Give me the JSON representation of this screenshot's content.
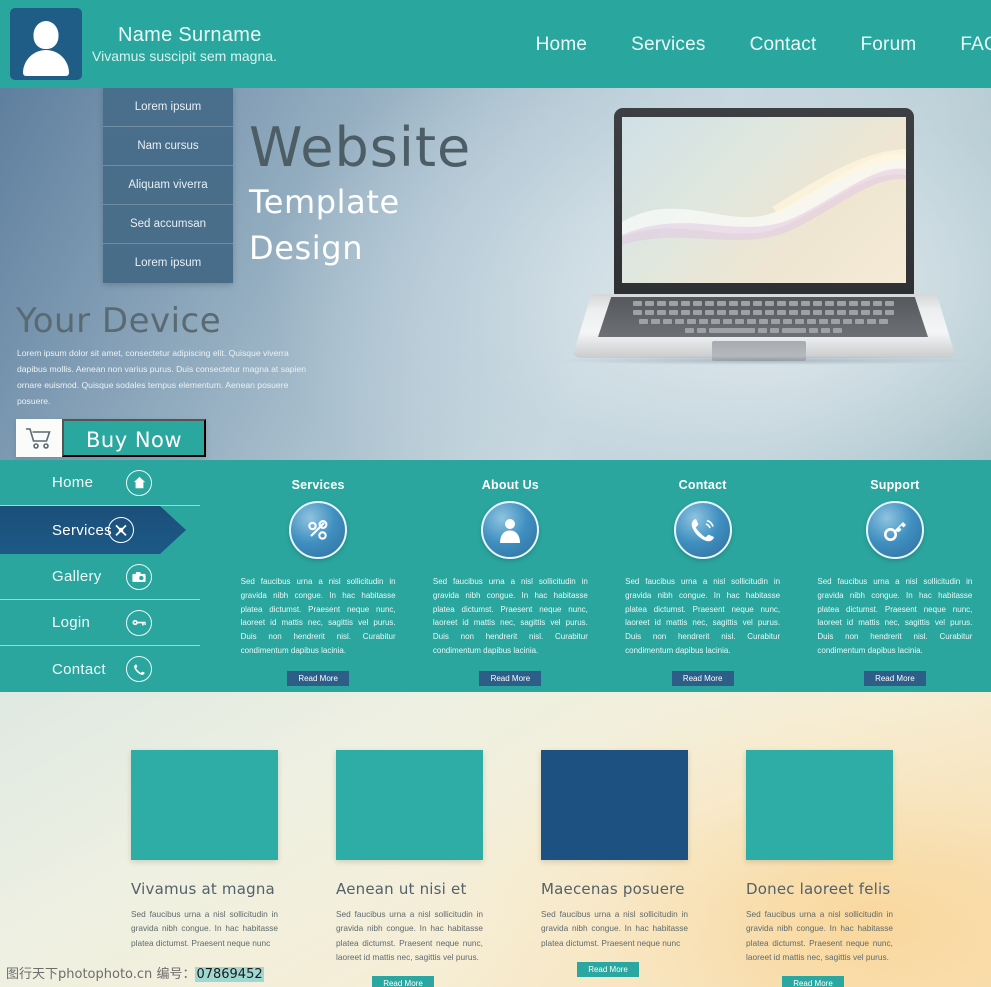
{
  "header": {
    "profile_name": "Name Surname",
    "profile_tagline": "Vivamus suscipit sem magna.",
    "avatar_icon": "user-avatar-icon",
    "nav": [
      {
        "label": "Home"
      },
      {
        "label": "Services"
      },
      {
        "label": "Contact"
      },
      {
        "label": "Forum"
      },
      {
        "label": "FAQ"
      }
    ],
    "bg_color": "#29a79f"
  },
  "dropdown": {
    "items": [
      {
        "label": "Lorem ipsum"
      },
      {
        "label": "Nam cursus"
      },
      {
        "label": "Aliquam viverra"
      },
      {
        "label": "Sed accumsan"
      },
      {
        "label": "Lorem ipsum"
      }
    ],
    "bg_color": "#4a6f8c"
  },
  "hero": {
    "title": "Website",
    "subtitle_line1": "Template",
    "subtitle_line2": "Design",
    "device_heading": "Your Device",
    "device_text": "Lorem ipsum dolor sit amet, consectetur adipiscing elit. Quisque viverra dapibus mollis. Aenean non varius purus. Duis consectetur magna at sapien ornare euismod. Quisque sodales tempus elementum. Aenean posuere posuere.",
    "buy_label": "Buy Now",
    "cart_icon": "shopping-cart-icon",
    "accent_color": "#2aa8a0"
  },
  "sidebar": {
    "items": [
      {
        "label": "Home",
        "icon": "home-icon",
        "glyph": "⌂",
        "active": false
      },
      {
        "label": "Services",
        "icon": "tools-icon",
        "glyph": "⚒",
        "active": true
      },
      {
        "label": "Gallery",
        "icon": "camera-icon",
        "glyph": "▣",
        "active": false
      },
      {
        "label": "Login",
        "icon": "key-icon",
        "glyph": "⚷",
        "active": false
      },
      {
        "label": "Contact",
        "icon": "phone-icon",
        "glyph": "☎",
        "active": false
      }
    ],
    "active_color": "#1b4f79"
  },
  "services": {
    "section_bg": "#2aa69f",
    "read_more_label": "Read More",
    "body_text": "Sed faucibus urna a nisl sollicitudin in gravida nibh congue. In hac habitasse platea dictumst. Praesent neque nunc, laoreet id mattis nec, sagittis vel purus. Duis non hendrerit nisl. Curabitur condimentum dapibus lacinia.",
    "cards": [
      {
        "title": "Services",
        "icon": "tools-gear-icon",
        "glyph": "⚙"
      },
      {
        "title": "About Us",
        "icon": "person-icon",
        "glyph": "♟"
      },
      {
        "title": "Contact",
        "icon": "phone-ring-icon",
        "glyph": "☎"
      },
      {
        "title": "Support",
        "icon": "key-icon",
        "glyph": "⚷"
      }
    ]
  },
  "portfolio": {
    "read_more_label": "Read More",
    "cards": [
      {
        "title": "Vivamus at magna",
        "text": "Sed faucibus urna a nisl sollicitudin in gravida nibh congue. In hac habitasse platea dictumst. Praesent neque nunc",
        "thumb_color": "#2dada5",
        "show_button": false
      },
      {
        "title": "Aenean ut nisi et",
        "text": "Sed faucibus urna a nisl sollicitudin in gravida nibh congue. In hac habitasse platea dictumst. Praesent neque nunc, laoreet id mattis nec, sagittis vel purus.",
        "thumb_color": "#2dada5",
        "show_button": true
      },
      {
        "title": "Maecenas posuere",
        "text": "Sed faucibus urna a nisl sollicitudin in gravida nibh congue. In hac habitasse platea dictumst. Praesent neque nunc",
        "thumb_color": "#1c5182",
        "show_button": true
      },
      {
        "title": "Donec laoreet felis",
        "text": "Sed faucibus urna a nisl sollicitudin in gravida nibh congue. In hac habitasse platea dictumst. Praesent neque nunc, laoreet id mattis nec, sagittis vel purus.",
        "thumb_color": "#2dada5",
        "show_button": true
      }
    ]
  },
  "watermark": {
    "site": "图行天下photophoto.cn",
    "label": "编号：",
    "id": "07869452"
  }
}
